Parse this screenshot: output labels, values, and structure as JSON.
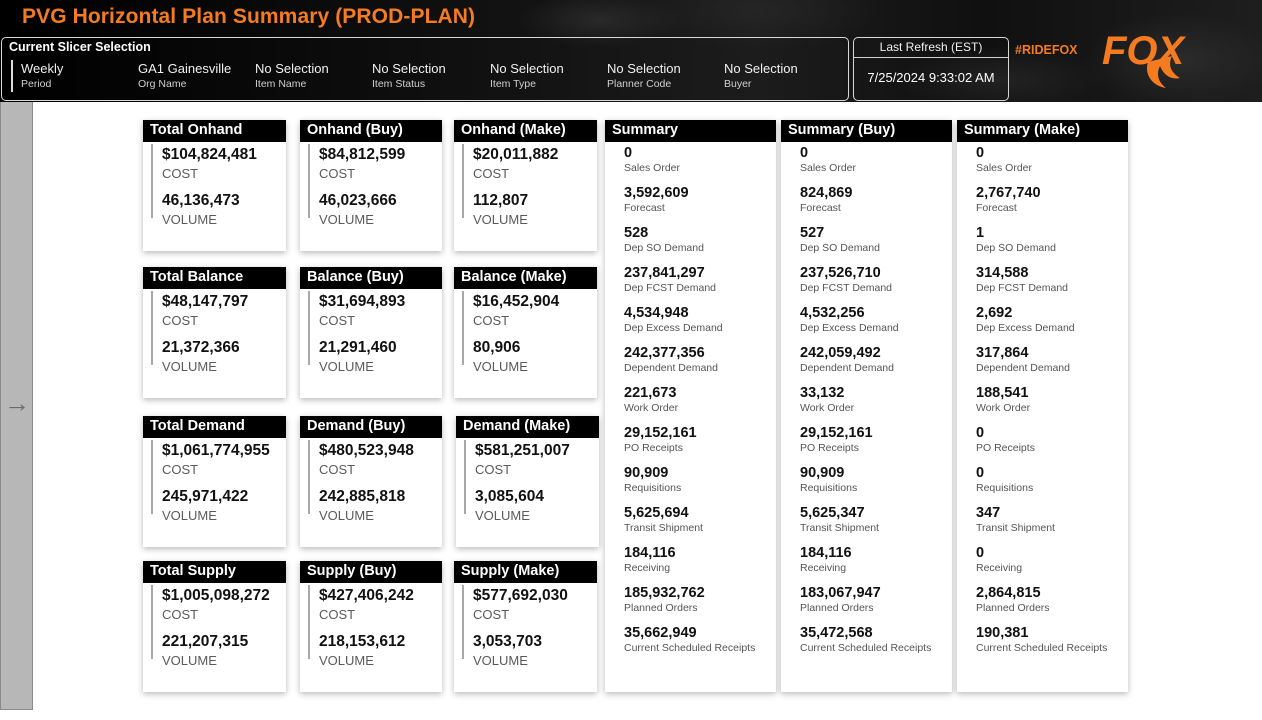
{
  "header": {
    "title": "PVG Horizontal Plan Summary (PROD-PLAN)",
    "hashtag": "#RIDEFOX",
    "brand_logo": "FOX",
    "accent_color": "#f47b20"
  },
  "slicer": {
    "title": "Current Slicer Selection",
    "items": [
      {
        "value": "Weekly",
        "label": "Period"
      },
      {
        "value": "GA1 Gainesville",
        "label": "Org Name"
      },
      {
        "value": "No Selection",
        "label": "Item Name"
      },
      {
        "value": "No Selection",
        "label": "Item Status"
      },
      {
        "value": "No Selection",
        "label": "Item Type"
      },
      {
        "value": "No Selection",
        "label": "Planner Code"
      },
      {
        "value": "No Selection",
        "label": "Buyer"
      }
    ]
  },
  "refresh": {
    "label": "Last Refresh (EST)",
    "value": "7/25/2024 9:33:02 AM"
  },
  "sidebar": {
    "icon": "arrow-right-icon",
    "arrow": "→"
  },
  "cards": [
    {
      "title": "Total Onhand",
      "cost": "$104,824,481",
      "cost_label": "COST",
      "volume": "46,136,473",
      "volume_label": "VOLUME"
    },
    {
      "title": "Onhand (Buy)",
      "cost": "$84,812,599",
      "cost_label": "COST",
      "volume": "46,023,666",
      "volume_label": "VOLUME"
    },
    {
      "title": "Onhand (Make)",
      "cost": "$20,011,882",
      "cost_label": "COST",
      "volume": "112,807",
      "volume_label": "VOLUME"
    },
    {
      "title": "Total Balance",
      "cost": "$48,147,797",
      "cost_label": "COST",
      "volume": "21,372,366",
      "volume_label": "VOLUME"
    },
    {
      "title": "Balance (Buy)",
      "cost": "$31,694,893",
      "cost_label": "COST",
      "volume": "21,291,460",
      "volume_label": "VOLUME"
    },
    {
      "title": "Balance (Make)",
      "cost": "$16,452,904",
      "cost_label": "COST",
      "volume": "80,906",
      "volume_label": "VOLUME"
    },
    {
      "title": "Total Demand",
      "cost": "$1,061,774,955",
      "cost_label": "COST",
      "volume": "245,971,422",
      "volume_label": "VOLUME"
    },
    {
      "title": "Demand (Buy)",
      "cost": "$480,523,948",
      "cost_label": "COST",
      "volume": "242,885,818",
      "volume_label": "VOLUME"
    },
    {
      "title": "Demand (Make)",
      "cost": "$581,251,007",
      "cost_label": "COST",
      "volume": "3,085,604",
      "volume_label": "VOLUME"
    },
    {
      "title": "Total Supply",
      "cost": "$1,005,098,272",
      "cost_label": "COST",
      "volume": "221,207,315",
      "volume_label": "VOLUME"
    },
    {
      "title": "Supply (Buy)",
      "cost": "$427,406,242",
      "cost_label": "COST",
      "volume": "218,153,612",
      "volume_label": "VOLUME"
    },
    {
      "title": "Supply (Make)",
      "cost": "$577,692,030",
      "cost_label": "COST",
      "volume": "3,053,703",
      "volume_label": "VOLUME"
    }
  ],
  "summaries": [
    {
      "title": "Summary",
      "items": [
        {
          "value": "0",
          "label": "Sales Order"
        },
        {
          "value": "3,592,609",
          "label": "Forecast"
        },
        {
          "value": "528",
          "label": "Dep SO Demand"
        },
        {
          "value": "237,841,297",
          "label": "Dep FCST Demand"
        },
        {
          "value": "4,534,948",
          "label": "Dep Excess Demand"
        },
        {
          "value": "242,377,356",
          "label": "Dependent Demand"
        },
        {
          "value": "221,673",
          "label": "Work Order"
        },
        {
          "value": "29,152,161",
          "label": "PO Receipts"
        },
        {
          "value": "90,909",
          "label": "Requisitions"
        },
        {
          "value": "5,625,694",
          "label": "Transit Shipment"
        },
        {
          "value": "184,116",
          "label": "Receiving"
        },
        {
          "value": "185,932,762",
          "label": "Planned Orders"
        },
        {
          "value": "35,662,949",
          "label": "Current Scheduled Receipts"
        }
      ]
    },
    {
      "title": "Summary (Buy)",
      "items": [
        {
          "value": "0",
          "label": "Sales Order"
        },
        {
          "value": "824,869",
          "label": "Forecast"
        },
        {
          "value": "527",
          "label": "Dep SO Demand"
        },
        {
          "value": "237,526,710",
          "label": "Dep FCST Demand"
        },
        {
          "value": "4,532,256",
          "label": "Dep Excess Demand"
        },
        {
          "value": "242,059,492",
          "label": "Dependent Demand"
        },
        {
          "value": "33,132",
          "label": "Work Order"
        },
        {
          "value": "29,152,161",
          "label": "PO Receipts"
        },
        {
          "value": "90,909",
          "label": "Requisitions"
        },
        {
          "value": "5,625,347",
          "label": "Transit Shipment"
        },
        {
          "value": "184,116",
          "label": "Receiving"
        },
        {
          "value": "183,067,947",
          "label": "Planned Orders"
        },
        {
          "value": "35,472,568",
          "label": "Current Scheduled Receipts"
        }
      ]
    },
    {
      "title": "Summary (Make)",
      "items": [
        {
          "value": "0",
          "label": "Sales Order"
        },
        {
          "value": "2,767,740",
          "label": "Forecast"
        },
        {
          "value": "1",
          "label": "Dep SO Demand"
        },
        {
          "value": "314,588",
          "label": "Dep FCST Demand"
        },
        {
          "value": "2,692",
          "label": "Dep Excess Demand"
        },
        {
          "value": "317,864",
          "label": "Dependent Demand"
        },
        {
          "value": "188,541",
          "label": "Work Order"
        },
        {
          "value": "0",
          "label": "PO Receipts"
        },
        {
          "value": "0",
          "label": "Requisitions"
        },
        {
          "value": "347",
          "label": "Transit Shipment"
        },
        {
          "value": "0",
          "label": "Receiving"
        },
        {
          "value": "2,864,815",
          "label": "Planned Orders"
        },
        {
          "value": "190,381",
          "label": "Current Scheduled Receipts"
        }
      ]
    }
  ]
}
